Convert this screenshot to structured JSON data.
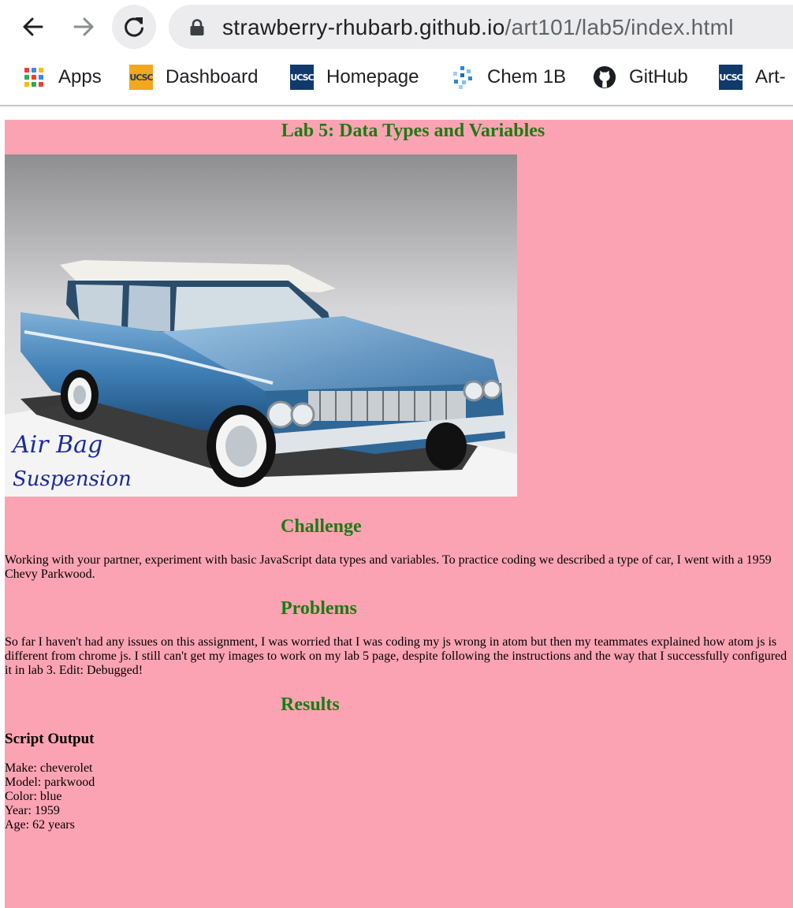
{
  "browser": {
    "url_host": "strawberry-rhubarb.github.io",
    "url_path": "/art101/lab5/index.html",
    "bookmarks": [
      {
        "label": "Apps",
        "icon": "apps-grid-icon"
      },
      {
        "label": "Dashboard",
        "icon": "ucsc-gold-icon"
      },
      {
        "label": "Homepage",
        "icon": "ucsc-blue-icon"
      },
      {
        "label": "Chem 1B",
        "icon": "chem-dots-icon"
      },
      {
        "label": "GitHub",
        "icon": "github-icon"
      },
      {
        "label": "Art-",
        "icon": "ucsc-blue-icon"
      }
    ],
    "ucsc_icon_text": "UCSC"
  },
  "page": {
    "title": "Lab 5: Data Types and Variables",
    "image_caption_line1": "Air Bag",
    "image_caption_line2": "Suspension",
    "challenge_heading": "Challenge",
    "challenge_text": "Working with your partner, experiment with basic JavaScript data types and variables. To practice coding we described a type of car, I went with a 1959 Chevy Parkwood.",
    "problems_heading": "Problems",
    "problems_text": "So far I haven't had any issues on this assignment, I was worried that I was coding my js wrong in atom but then my teammates explained how atom js is different from chrome js. I still can't get my images to work on my lab 5 page, despite following the instructions and the way that I successfully configured it in lab 3. Edit: Debugged!",
    "results_heading": "Results",
    "output_heading": "Script Output",
    "output": [
      "Make: cheverolet",
      "Model: parkwood",
      "Color: blue",
      "Year: 1959",
      "Age: 62 years"
    ]
  },
  "colors": {
    "page_background": "#fca3b3",
    "heading_green": "#1d7a12",
    "car_blue": "#3f7fb5"
  }
}
